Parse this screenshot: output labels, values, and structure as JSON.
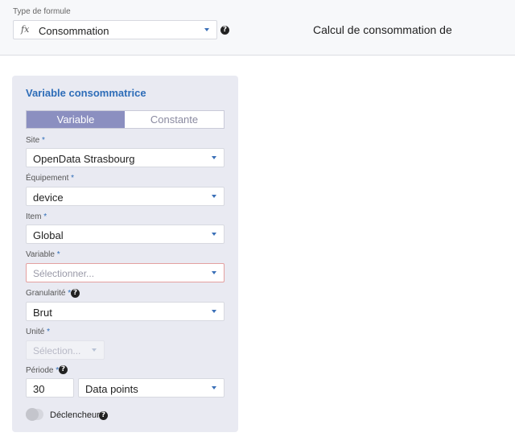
{
  "header": {
    "formula_type_label": "Type de formule",
    "formula_icon": "fx",
    "formula_value": "Consommation",
    "calc_label": "Calcul de consommation de"
  },
  "panel": {
    "title": "Variable consommatrice",
    "tabs": [
      "Variable",
      "Constante"
    ],
    "active_tab": "Variable",
    "fields": {
      "site": {
        "label": "Site",
        "required": "*",
        "value": "OpenData Strasbourg"
      },
      "equipement": {
        "label": "Équipement",
        "required": "*",
        "value": "device"
      },
      "item": {
        "label": "Item",
        "required": "*",
        "value": "Global"
      },
      "variable": {
        "label": "Variable",
        "required": "*",
        "placeholder": "Sélectionner..."
      },
      "granularite": {
        "label": "Granularité",
        "required": "*",
        "value": "Brut"
      },
      "unite": {
        "label": "Unité",
        "required": "*",
        "placeholder": "Sélection..."
      },
      "periode": {
        "label": "Période",
        "required": "*",
        "number": "30",
        "unit": "Data points"
      }
    },
    "trigger": {
      "label": "Déclencheur",
      "enabled": false
    }
  },
  "help_glyph": "?",
  "colors": {
    "accent_blue": "#2e6db8",
    "active_tab": "#8b8fc0",
    "panel_bg": "#e9eaf2",
    "error_border": "#e4a0a0"
  }
}
